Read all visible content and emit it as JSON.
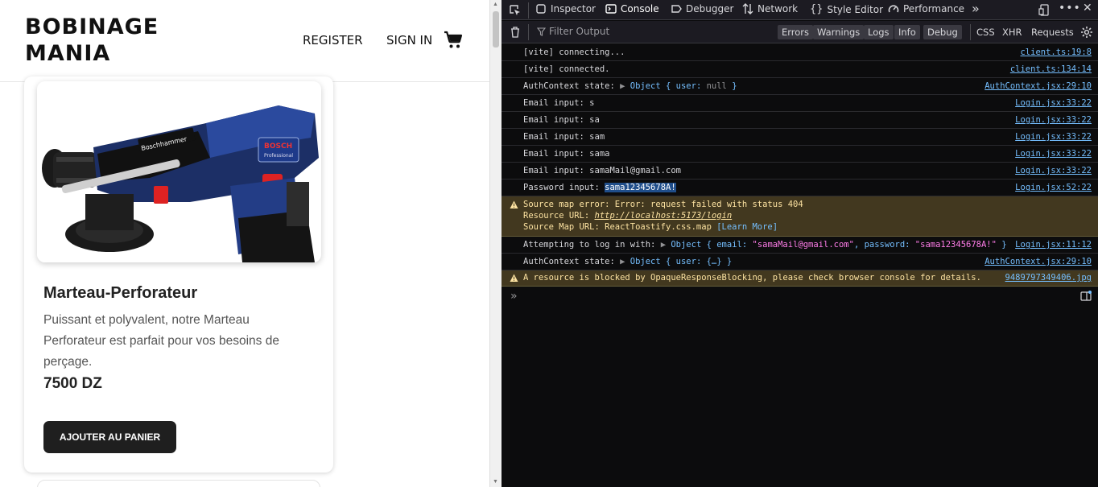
{
  "site": {
    "logo_line1": "BOBINAGE",
    "logo_line2": "MANIA",
    "nav_register": "REGISTER",
    "nav_signin": "SIGN IN",
    "cart_icon": "shopping-cart-icon"
  },
  "product": {
    "title": "Marteau-Perforateur",
    "description": "Puissant et polyvalent, notre Marteau Perforateur est parfait pour vos besoins de perçage.",
    "price": "7500 DZ",
    "add_button": "AJOUTER AU PANIER",
    "image_brand_label": "Boschhammer",
    "image_brand_badge": "BOSCH",
    "image_brand_sub": "Professional"
  },
  "devtools": {
    "tabs": [
      "Inspector",
      "Console",
      "Debugger",
      "Network",
      "Style Editor",
      "Performance"
    ],
    "active_tab": "Console",
    "filter_placeholder": "Filter Output",
    "levels": [
      "Errors",
      "Warnings",
      "Logs",
      "Info",
      "Debug"
    ],
    "net_filters": [
      "CSS",
      "XHR",
      "Requests"
    ],
    "colors": {
      "bg": "#0c0c0d",
      "link": "#75bfff",
      "warning_bg": "#42381f",
      "warning_text": "#fce2a1",
      "string": "#ff7de9"
    },
    "logs": [
      {
        "msg": "[vite] connecting...",
        "src": "client.ts:19:8"
      },
      {
        "msg": "[vite] connected.",
        "src": "client.ts:134:14"
      },
      {
        "msg_prefix": "AuthContext state: ",
        "obj": "Object { user: ",
        "nul": "null",
        "obj_end": " }",
        "src": "AuthContext.jsx:29:10"
      },
      {
        "msg": "Email input: s",
        "src": "Login.jsx:33:22"
      },
      {
        "msg": "Email input: sa",
        "src": "Login.jsx:33:22"
      },
      {
        "msg": "Email input: sam",
        "src": "Login.jsx:33:22"
      },
      {
        "msg": "Email input: sama",
        "src": "Login.jsx:33:22"
      },
      {
        "msg": "Email input: samaMail@gmail.com",
        "src": "Login.jsx:33:22"
      },
      {
        "msg_prefix": "Password input: ",
        "highlight": "sama12345678A!",
        "src": "Login.jsx:52:22"
      }
    ],
    "source_map_warning": {
      "line1": "Source map error: Error: request failed with status 404",
      "line2_prefix": "Resource URL: ",
      "line2_link": "http://localhost:5173/login",
      "line3_prefix": "Source Map URL: ReactToastify.css.map ",
      "line3_link": "[Learn More]"
    },
    "attempt_log": {
      "prefix": "Attempting to log in with: ",
      "obj_start": "Object { email: ",
      "email": "\"samaMail@gmail.com\"",
      "mid": ", password: ",
      "password": "\"sama12345678A!\"",
      "obj_end": " }",
      "src": "Login.jsx:11:12"
    },
    "auth_log2": {
      "prefix": "AuthContext state: ",
      "obj": "Object { user: {…} }",
      "src": "AuthContext.jsx:29:10"
    },
    "blocked_warning": {
      "msg": "A resource is blocked by OpaqueResponseBlocking, please check browser console for details.",
      "src": "9489797349406.jpg"
    },
    "prompt": "»"
  }
}
